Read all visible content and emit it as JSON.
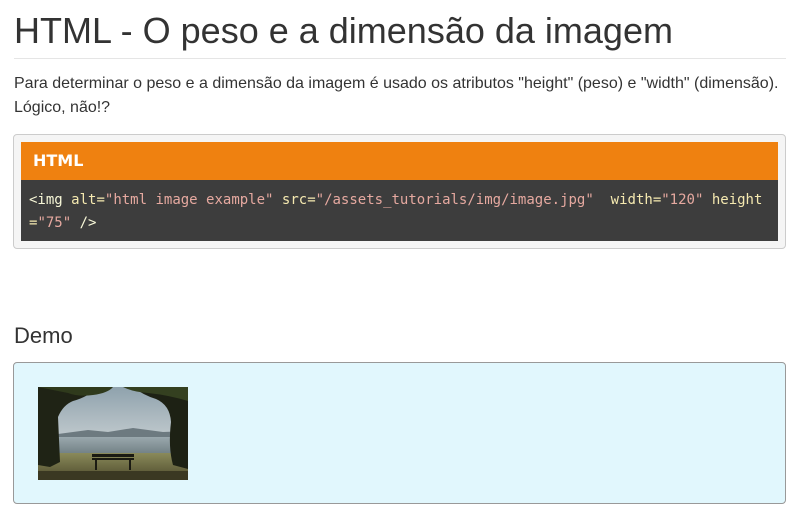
{
  "page": {
    "title": "HTML - O peso e a dimensão da imagem",
    "intro": "Para determinar o peso e a dimensão da imagem é usado os atributos \"height\" (peso) e \"width\" (dimensão). Lógico, não!?"
  },
  "code_panel": {
    "header_label": "HTML",
    "tokens": {
      "tag_open": "<img",
      "alt_attr": "alt",
      "alt_val": "\"html image example\"",
      "src_attr": "src",
      "src_val": "\"/assets_tutorials/img/image.jpg\"",
      "width_attr": "width",
      "width_val": "\"120\"",
      "height_attr": "height",
      "height_val": "\"75\"",
      "tag_close": "/>"
    },
    "eq": "="
  },
  "demo": {
    "heading": "Demo",
    "image_alt": "html image example"
  },
  "colors": {
    "code_header_bg": "#ef8110",
    "code_body_bg": "#3d3d3d",
    "demo_bg": "#e1f7fd"
  }
}
